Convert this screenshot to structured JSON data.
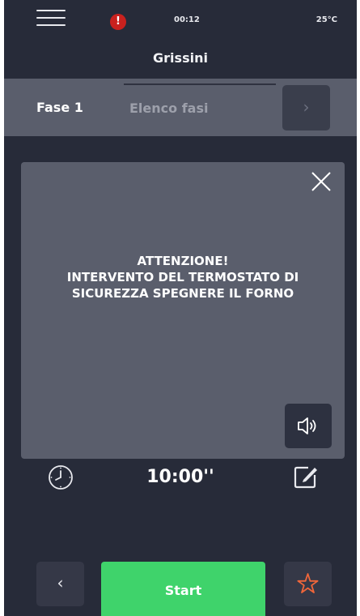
{
  "status_bar": {
    "menu_icon": "hamburger-menu-icon",
    "alert_icon": "alert-icon",
    "alert_symbol": "!",
    "time": "00:12",
    "temperature": "25°C"
  },
  "header": {
    "title": "Grissini"
  },
  "phase_bar": {
    "current_phase": "Fase 1",
    "phase_list_label": "Elenco fasi",
    "next_icon": "chevron-right-icon"
  },
  "alert_modal": {
    "close_icon": "close-icon",
    "message_line1": "ATTENZIONE!",
    "message_line2": "INTERVENTO DEL TERMOSTATO DI",
    "message_line3": "SICUREZZA SPEGNERE IL FORNO",
    "sound_icon": "speaker-icon"
  },
  "timer": {
    "timer_icon": "clock-icon",
    "value": "10:00''",
    "edit_icon": "edit-icon"
  },
  "footer": {
    "back_icon": "chevron-left-icon",
    "start_label": "Start",
    "favorite_icon": "star-icon"
  },
  "colors": {
    "background": "#272b39",
    "panel": "#5a5e6c",
    "start_green": "#3fd36b",
    "alert_red": "#c9211e",
    "favorite_orange": "#f0663a"
  }
}
